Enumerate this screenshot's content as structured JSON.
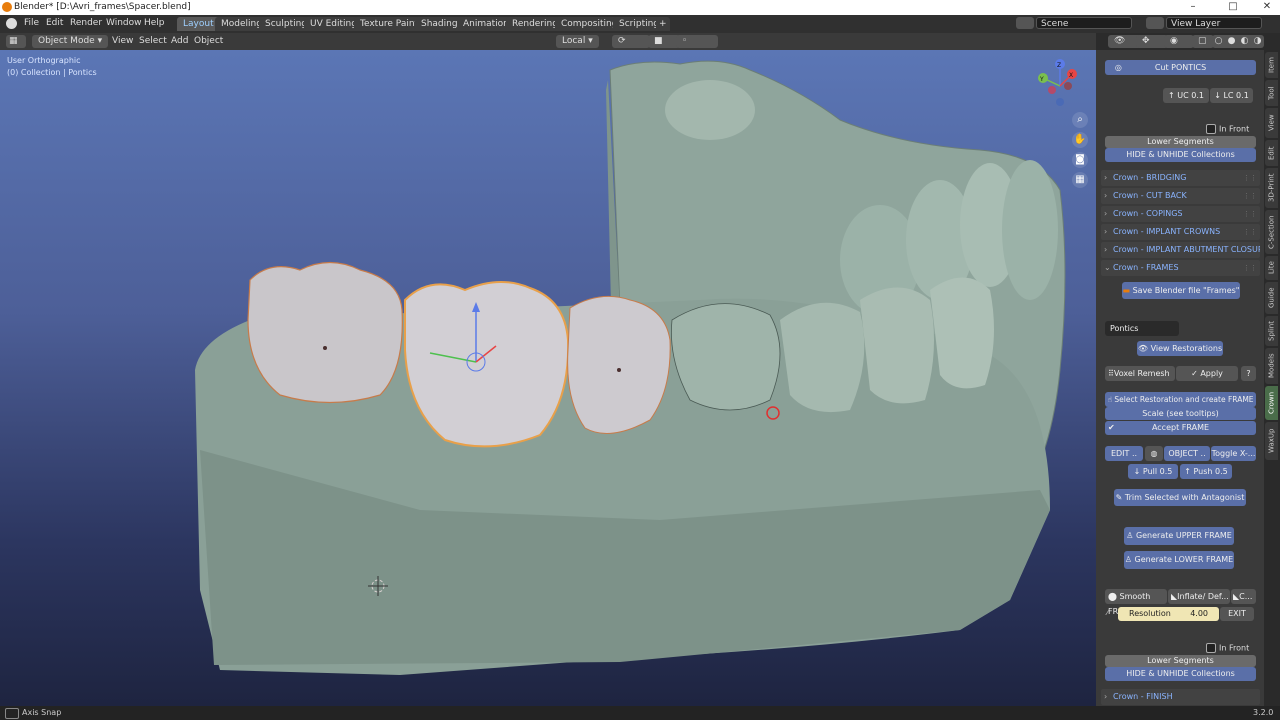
{
  "window": {
    "title": "Blender* [D:\\Avri_frames\\Spacer.blend]",
    "controls": [
      "–",
      "□",
      "✕"
    ]
  },
  "menubar": {
    "menus": [
      "File",
      "Edit",
      "Render",
      "Window",
      "Help"
    ],
    "workspaces": [
      "Layout",
      "Modeling",
      "Sculpting",
      "UV Editing",
      "Texture Paint",
      "Shading",
      "Animation",
      "Rendering",
      "Compositing",
      "Scripting"
    ],
    "add_tab": "+",
    "scene": "Scene",
    "view_layer": "View Layer"
  },
  "header": {
    "mode": "Object Mode",
    "menus": [
      "View",
      "Select",
      "Add",
      "Object"
    ],
    "transform_orientation": "Local"
  },
  "viewport": {
    "view_name": "User Orthographic",
    "collection": "(0) Collection | Pontics",
    "gizmo_axes": [
      "Z",
      "Y",
      "X"
    ]
  },
  "sidebar": {
    "cut_pontics": "Cut PONTICS",
    "uc": "UC 0.1",
    "lc": "LC 0.1",
    "in_front_1": "In Front",
    "lower_segments_1": "Lower Segments",
    "hide_unhide_1": "HIDE & UNHIDE Collections",
    "sections": [
      {
        "label": "Crown - BRIDGING",
        "arrow": "›"
      },
      {
        "label": "Crown - CUT BACK",
        "arrow": "›"
      },
      {
        "label": "Crown - COPINGS",
        "arrow": "›"
      },
      {
        "label": "Crown - IMPLANT CROWNS",
        "arrow": "›"
      },
      {
        "label": "Crown - IMPLANT  ABUTMENT CLOSUR",
        "arrow": "›"
      },
      {
        "label": "Crown - FRAMES",
        "arrow": "⌄"
      }
    ],
    "save_frames": "Save Blender file \"Frames\"",
    "pontics_field": "Pontics",
    "view_restorations": "View Restorations",
    "voxel_remesh": "Voxel Remesh",
    "apply": "Apply",
    "select_restoration": "Select Restoration and create FRAME",
    "scale_tooltips": "Scale (see tooltips)",
    "accept_frame": "Accept FRAME",
    "edit": "EDIT ..",
    "object": "OBJECT ..",
    "toggle": "Toggle X-...",
    "pull": "Pull 0.5",
    "push": "Push 0.5",
    "trim_selected": "Trim Selected with Antagonist",
    "gen_upper": "Generate UPPER FRAME",
    "gen_lower": "Generate LOWER FRAME",
    "smooth": "Smooth FR...",
    "inflate": "Inflate/ Def...",
    "c_btn": "C...",
    "resolution_label": "Resolution",
    "resolution_value": "4.00",
    "exit": "EXIT",
    "in_front_2": "In Front",
    "lower_segments_2": "Lower Segments",
    "hide_unhide_2": "HIDE & UNHIDE Collections",
    "finish": "Crown - FINISH"
  },
  "tabs": [
    "Item",
    "Tool",
    "View",
    "Edit",
    "3D-Print",
    "C-Section",
    "Lite",
    "Guide",
    "Splint",
    "Models",
    "Crown",
    "WaxUp"
  ],
  "active_tab": "Crown",
  "status": {
    "left": "Axis Snap",
    "version": "3.2.0"
  },
  "colors": {
    "accent_blue": "#5a6fa8",
    "section_text": "#8ab4ff",
    "active_workspace": "#9fd0ff",
    "selection_outline": "#e8a04a",
    "active_tab": "#4a6d4a"
  }
}
